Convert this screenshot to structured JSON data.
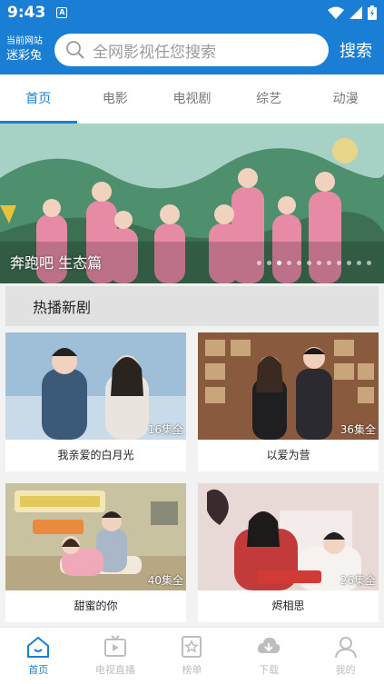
{
  "status_bar": {
    "time": "9:43",
    "notif_badge": "A"
  },
  "header": {
    "site_label": "当前网站",
    "site_name": "迷彩兔",
    "search_placeholder": "全网影视任您搜索",
    "search_button": "搜索",
    "accent_color": "#1a7fd4"
  },
  "tabs": [
    {
      "label": "首页",
      "active": true
    },
    {
      "label": "电影",
      "active": false
    },
    {
      "label": "电视剧",
      "active": false
    },
    {
      "label": "综艺",
      "active": false
    },
    {
      "label": "动漫",
      "active": false
    }
  ],
  "banner": {
    "caption": "奔跑吧 生态篇",
    "dot_count": 12,
    "active_dot": 2
  },
  "section": {
    "title": "热播新剧"
  },
  "cards": [
    {
      "title": "我亲爱的白月光",
      "episodes": "16集全"
    },
    {
      "title": "以爱为营",
      "episodes": "36集全"
    },
    {
      "title": "甜蜜的你",
      "episodes": "40集全"
    },
    {
      "title": "烬相思",
      "episodes": "26集全"
    }
  ],
  "bottom_nav": [
    {
      "label": "首页",
      "icon": "home-icon",
      "active": true
    },
    {
      "label": "电视直播",
      "icon": "tv-icon",
      "active": false
    },
    {
      "label": "榜单",
      "icon": "ranking-icon",
      "active": false
    },
    {
      "label": "下载",
      "icon": "download-icon",
      "active": false
    },
    {
      "label": "我的",
      "icon": "user-icon",
      "active": false
    }
  ]
}
